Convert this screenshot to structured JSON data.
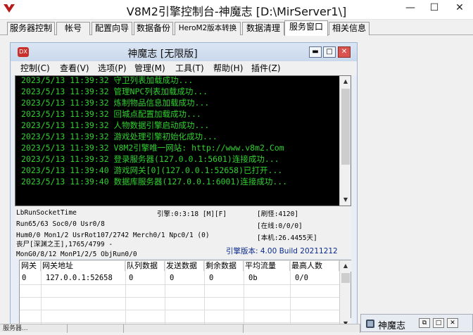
{
  "app": {
    "title": "V8M2引擎控制台-神魔志 [D:\\MirServer1\\]",
    "controls": {
      "minimize": "—",
      "maximize": "☐",
      "close": "✕"
    }
  },
  "tabs": [
    "服务器控制",
    "帐号",
    "配置向导",
    "数据备份",
    "HeroM2版本转换",
    "数据清理",
    "服务窗口",
    "相关信息"
  ],
  "active_tab": "服务窗口",
  "inner_window": {
    "title": "神魔志 [无限版]",
    "icon_text": "DX",
    "menus": [
      "控制(C)",
      "查看(V)",
      "选项(P)",
      "管理(M)",
      "工具(T)",
      "帮助(H)",
      "插件(Z)"
    ]
  },
  "log_lines": [
    "2023/5/13 11:39:32 守卫列表加载成功...",
    "2023/5/13 11:39:32 管理NPC列表加载成功...",
    "2023/5/13 11:39:32 炼制物品信息加载成功...",
    "2023/5/13 11:39:32 回城点配置加载成功...",
    "2023/5/13 11:39:32 人物数据引擎启动成功...",
    "2023/5/13 11:39:32 游戏处理引擎初始化成功...",
    "2023/5/13 11:39:32 V8M2引擎唯一网站: http://www.v8m2.Com",
    "2023/5/13 11:39:32 登录服务器(127.0.0.1:5601)连接成功...",
    "2023/5/13 11:39:40 游戏网关[0](127.0.0.1:52658)已打开...",
    "2023/5/13 11:39:40 数据库服务器(127.0.0.1:6001)连接成功..."
  ],
  "status": {
    "socket": "LbRunSocketTime",
    "run": "Run65/63 Soc0/0 Usr0/8",
    "hum": "Hum0/0 Mon1/2 UsrRot107/2742 Merch0/1 Npc0/1 (0)",
    "map": "丧尸[深渊之王],1765/4799 -",
    "mon": "MonG0/8/12 MonP1/2/5 ObjRun0/0",
    "engine": "引擎:0:3:18 [M][F]",
    "refresh": "[刷怪:4120]",
    "online": "[在线:0/0/0]",
    "local": "[本机:26.4455天]",
    "version": "引擎版本: 4.00 Build 20211212"
  },
  "grid": {
    "headers": [
      "网关",
      "网关地址",
      "队列数据",
      "发送数据",
      "剩余数据",
      "平均流量",
      "最高人数"
    ],
    "rows": [
      [
        "0",
        "127.0.0.1:52658",
        "0",
        "0",
        "0",
        "0b",
        "0/0"
      ]
    ]
  },
  "taskbar": {
    "window_title": "神魔志",
    "left_segments": [
      "服务器...",
      "",
      "",
      ""
    ]
  }
}
